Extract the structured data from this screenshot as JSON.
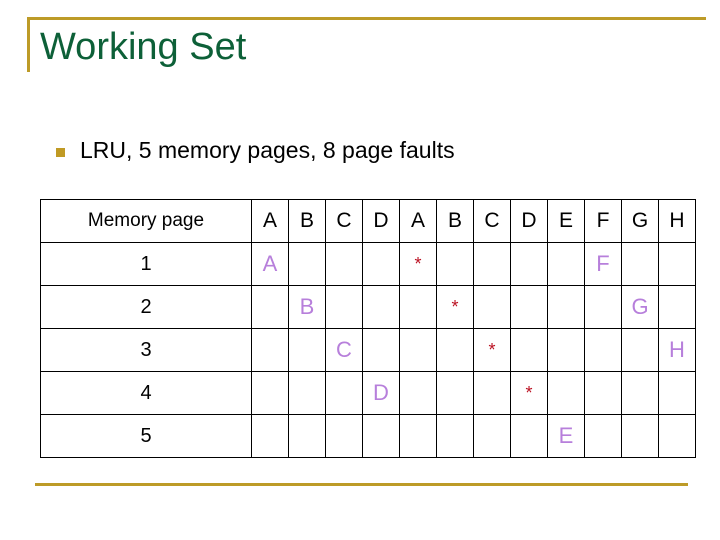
{
  "slide": {
    "title": "Working Set",
    "bullets": [
      {
        "marker": "square-bullet",
        "text": "LRU, 5 memory pages, 8 page faults"
      }
    ],
    "accent_gold": "#bd9b28",
    "title_green": "#0d6038",
    "page_letter_purple": "#b77fdb",
    "fault_red": "#bb1122"
  },
  "table": {
    "row_label_header": "Memory page",
    "reference_string": [
      "A",
      "B",
      "C",
      "D",
      "A",
      "B",
      "C",
      "D",
      "E",
      "F",
      "G",
      "H"
    ],
    "rows": [
      {
        "label": "1",
        "cells": [
          "A",
          "",
          "",
          "",
          "*",
          "",
          "",
          "",
          "",
          "F",
          "",
          ""
        ]
      },
      {
        "label": "2",
        "cells": [
          "",
          "B",
          "",
          "",
          "",
          "*",
          "",
          "",
          "",
          "",
          "G",
          ""
        ]
      },
      {
        "label": "3",
        "cells": [
          "",
          "",
          "C",
          "",
          "",
          "",
          "*",
          "",
          "",
          "",
          "",
          "H"
        ]
      },
      {
        "label": "4",
        "cells": [
          "",
          "",
          "",
          "D",
          "",
          "",
          "",
          "*",
          "",
          "",
          "",
          ""
        ]
      },
      {
        "label": "5",
        "cells": [
          "",
          "",
          "",
          "",
          "",
          "",
          "",
          "",
          "E",
          "",
          "",
          ""
        ]
      }
    ],
    "fault_glyph": "*"
  }
}
